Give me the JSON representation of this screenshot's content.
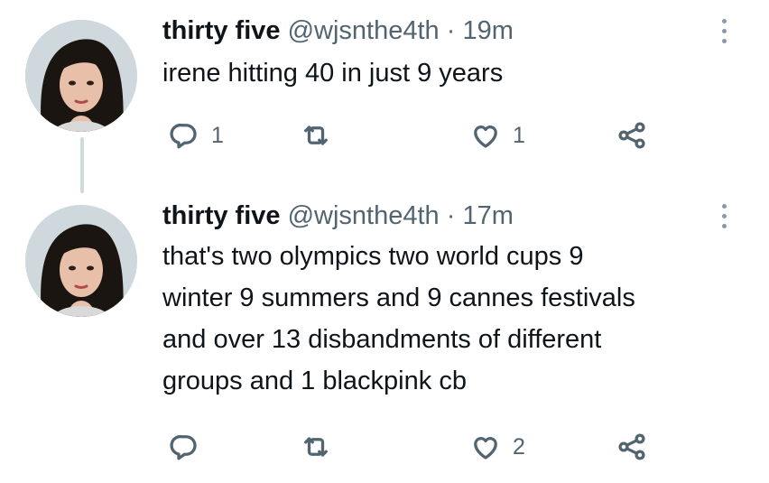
{
  "tweets": [
    {
      "display_name": "thirty five",
      "handle": "@wjsnthe4th",
      "separator": "·",
      "time": "19m",
      "text": "irene hitting 40 in just 9 years",
      "replies": "1",
      "retweets": "",
      "likes": "1"
    },
    {
      "display_name": "thirty five",
      "handle": "@wjsnthe4th",
      "separator": "·",
      "time": "17m",
      "text": "that's two olympics two world cups 9\nwinter 9 summers and 9 cannes festivals\nand over 13 disbandments of different\ngroups and 1 blackpink cb",
      "replies": "",
      "retweets": "",
      "likes": "2"
    }
  ],
  "icons": {
    "reply": "reply-icon",
    "retweet": "retweet-icon",
    "like": "heart-icon",
    "share": "share-icon",
    "more": "more-options-icon"
  },
  "colors": {
    "text": "#0f1419",
    "secondary": "#536471",
    "thread_line": "#cfd9de"
  }
}
